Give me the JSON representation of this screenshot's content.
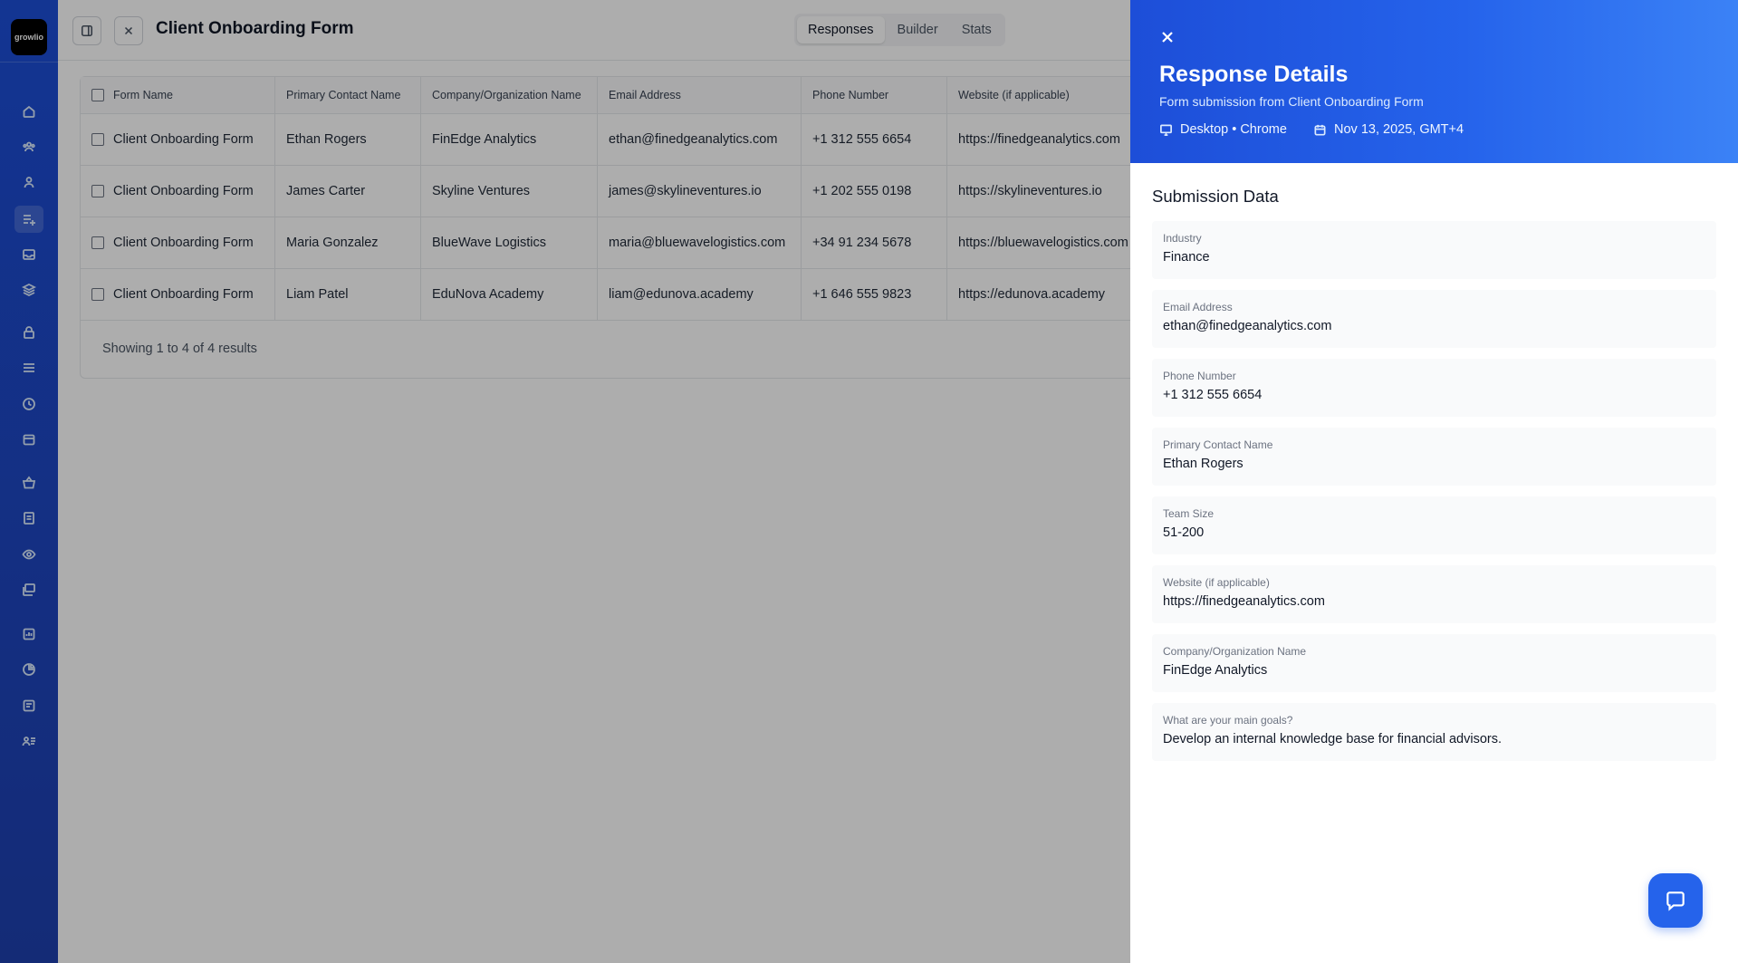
{
  "app": {
    "logo_text": "growlio"
  },
  "header": {
    "title": "Client Onboarding Form",
    "tabs": [
      {
        "label": "Responses",
        "active": true
      },
      {
        "label": "Builder",
        "active": false
      },
      {
        "label": "Stats",
        "active": false
      }
    ]
  },
  "nav": {
    "icons": [
      "home-icon",
      "groups-icon",
      "user-icon",
      "form-add-icon",
      "inbox-icon",
      "layers-icon",
      "lock-icon",
      "list-icon",
      "clock-icon",
      "calendar-icon",
      "basket-icon",
      "document-icon",
      "eye-icon",
      "stack-icon",
      "chart-icon",
      "pie-chart-icon",
      "report-icon",
      "user-list-icon"
    ],
    "active_index": 3
  },
  "table": {
    "columns": [
      "Form Name",
      "Primary Contact Name",
      "Company/Organization Name",
      "Email Address",
      "Phone Number",
      "Website (if applicable)"
    ],
    "rows": [
      [
        "Client Onboarding Form",
        "Ethan Rogers",
        "FinEdge Analytics",
        "ethan@finedgeanalytics.com",
        "+1 312 555 6654",
        "https://finedgeanalytics.com"
      ],
      [
        "Client Onboarding Form",
        "James Carter",
        "Skyline Ventures",
        "james@skylineventures.io",
        "+1 202 555 0198",
        "https://skylineventures.io"
      ],
      [
        "Client Onboarding Form",
        "Maria Gonzalez",
        "BlueWave Logistics",
        "maria@bluewavelogistics.com",
        "+34 91 234 5678",
        "https://bluewavelogistics.com"
      ],
      [
        "Client Onboarding Form",
        "Liam Patel",
        "EduNova Academy",
        "liam@edunova.academy",
        "+1 646 555 9823",
        "https://edunova.academy"
      ]
    ],
    "footer": "Showing 1 to 4 of 4 results"
  },
  "drawer": {
    "title": "Response Details",
    "subtitle": "Form submission from Client Onboarding Form",
    "device": "Desktop • Chrome",
    "date": "Nov 13, 2025, GMT+4",
    "section_title": "Submission Data",
    "fields": [
      {
        "label": "Industry",
        "value": "Finance"
      },
      {
        "label": "Email Address",
        "value": "ethan@finedgeanalytics.com"
      },
      {
        "label": "Phone Number",
        "value": "+1 312 555 6654"
      },
      {
        "label": "Primary Contact Name",
        "value": "Ethan Rogers"
      },
      {
        "label": "Team Size",
        "value": "51-200"
      },
      {
        "label": "Website (if applicable)",
        "value": "https://finedgeanalytics.com"
      },
      {
        "label": "Company/Organization Name",
        "value": "FinEdge Analytics"
      },
      {
        "label": "What are your main goals?",
        "value": "Develop an internal knowledge base for financial advisors."
      }
    ]
  },
  "colors": {
    "accent": "#2563eb",
    "rail": "#1d4ed8"
  }
}
